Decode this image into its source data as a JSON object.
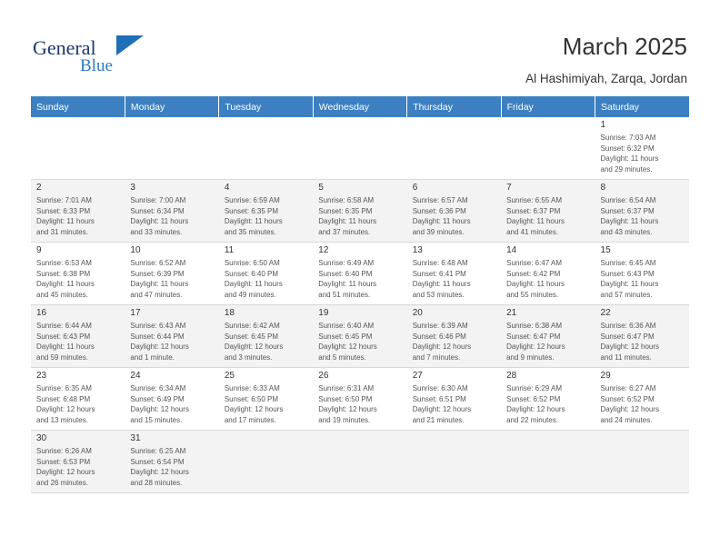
{
  "brand": {
    "name_part1": "General",
    "name_part2": "Blue",
    "flag_icon": "flag-icon"
  },
  "header": {
    "title": "March 2025",
    "location": "Al Hashimiyah, Zarqa, Jordan"
  },
  "calendar": {
    "weekday_headers": [
      "Sunday",
      "Monday",
      "Tuesday",
      "Wednesday",
      "Thursday",
      "Friday",
      "Saturday"
    ],
    "weeks": [
      [
        {
          "day": "",
          "info": ""
        },
        {
          "day": "",
          "info": ""
        },
        {
          "day": "",
          "info": ""
        },
        {
          "day": "",
          "info": ""
        },
        {
          "day": "",
          "info": ""
        },
        {
          "day": "",
          "info": ""
        },
        {
          "day": "1",
          "info": "Sunrise: 7:03 AM\nSunset: 6:32 PM\nDaylight: 11 hours\nand 29 minutes."
        }
      ],
      [
        {
          "day": "2",
          "info": "Sunrise: 7:01 AM\nSunset: 6:33 PM\nDaylight: 11 hours\nand 31 minutes."
        },
        {
          "day": "3",
          "info": "Sunrise: 7:00 AM\nSunset: 6:34 PM\nDaylight: 11 hours\nand 33 minutes."
        },
        {
          "day": "4",
          "info": "Sunrise: 6:59 AM\nSunset: 6:35 PM\nDaylight: 11 hours\nand 35 minutes."
        },
        {
          "day": "5",
          "info": "Sunrise: 6:58 AM\nSunset: 6:35 PM\nDaylight: 11 hours\nand 37 minutes."
        },
        {
          "day": "6",
          "info": "Sunrise: 6:57 AM\nSunset: 6:36 PM\nDaylight: 11 hours\nand 39 minutes."
        },
        {
          "day": "7",
          "info": "Sunrise: 6:55 AM\nSunset: 6:37 PM\nDaylight: 11 hours\nand 41 minutes."
        },
        {
          "day": "8",
          "info": "Sunrise: 6:54 AM\nSunset: 6:37 PM\nDaylight: 11 hours\nand 43 minutes."
        }
      ],
      [
        {
          "day": "9",
          "info": "Sunrise: 6:53 AM\nSunset: 6:38 PM\nDaylight: 11 hours\nand 45 minutes."
        },
        {
          "day": "10",
          "info": "Sunrise: 6:52 AM\nSunset: 6:39 PM\nDaylight: 11 hours\nand 47 minutes."
        },
        {
          "day": "11",
          "info": "Sunrise: 6:50 AM\nSunset: 6:40 PM\nDaylight: 11 hours\nand 49 minutes."
        },
        {
          "day": "12",
          "info": "Sunrise: 6:49 AM\nSunset: 6:40 PM\nDaylight: 11 hours\nand 51 minutes."
        },
        {
          "day": "13",
          "info": "Sunrise: 6:48 AM\nSunset: 6:41 PM\nDaylight: 11 hours\nand 53 minutes."
        },
        {
          "day": "14",
          "info": "Sunrise: 6:47 AM\nSunset: 6:42 PM\nDaylight: 11 hours\nand 55 minutes."
        },
        {
          "day": "15",
          "info": "Sunrise: 6:45 AM\nSunset: 6:43 PM\nDaylight: 11 hours\nand 57 minutes."
        }
      ],
      [
        {
          "day": "16",
          "info": "Sunrise: 6:44 AM\nSunset: 6:43 PM\nDaylight: 11 hours\nand 59 minutes."
        },
        {
          "day": "17",
          "info": "Sunrise: 6:43 AM\nSunset: 6:44 PM\nDaylight: 12 hours\nand 1 minute."
        },
        {
          "day": "18",
          "info": "Sunrise: 6:42 AM\nSunset: 6:45 PM\nDaylight: 12 hours\nand 3 minutes."
        },
        {
          "day": "19",
          "info": "Sunrise: 6:40 AM\nSunset: 6:45 PM\nDaylight: 12 hours\nand 5 minutes."
        },
        {
          "day": "20",
          "info": "Sunrise: 6:39 AM\nSunset: 6:46 PM\nDaylight: 12 hours\nand 7 minutes."
        },
        {
          "day": "21",
          "info": "Sunrise: 6:38 AM\nSunset: 6:47 PM\nDaylight: 12 hours\nand 9 minutes."
        },
        {
          "day": "22",
          "info": "Sunrise: 6:36 AM\nSunset: 6:47 PM\nDaylight: 12 hours\nand 11 minutes."
        }
      ],
      [
        {
          "day": "23",
          "info": "Sunrise: 6:35 AM\nSunset: 6:48 PM\nDaylight: 12 hours\nand 13 minutes."
        },
        {
          "day": "24",
          "info": "Sunrise: 6:34 AM\nSunset: 6:49 PM\nDaylight: 12 hours\nand 15 minutes."
        },
        {
          "day": "25",
          "info": "Sunrise: 6:33 AM\nSunset: 6:50 PM\nDaylight: 12 hours\nand 17 minutes."
        },
        {
          "day": "26",
          "info": "Sunrise: 6:31 AM\nSunset: 6:50 PM\nDaylight: 12 hours\nand 19 minutes."
        },
        {
          "day": "27",
          "info": "Sunrise: 6:30 AM\nSunset: 6:51 PM\nDaylight: 12 hours\nand 21 minutes."
        },
        {
          "day": "28",
          "info": "Sunrise: 6:29 AM\nSunset: 6:52 PM\nDaylight: 12 hours\nand 22 minutes."
        },
        {
          "day": "29",
          "info": "Sunrise: 6:27 AM\nSunset: 6:52 PM\nDaylight: 12 hours\nand 24 minutes."
        }
      ],
      [
        {
          "day": "30",
          "info": "Sunrise: 6:26 AM\nSunset: 6:53 PM\nDaylight: 12 hours\nand 26 minutes."
        },
        {
          "day": "31",
          "info": "Sunrise: 6:25 AM\nSunset: 6:54 PM\nDaylight: 12 hours\nand 28 minutes."
        },
        {
          "day": "",
          "info": ""
        },
        {
          "day": "",
          "info": ""
        },
        {
          "day": "",
          "info": ""
        },
        {
          "day": "",
          "info": ""
        },
        {
          "day": "",
          "info": ""
        }
      ]
    ]
  },
  "colors": {
    "header_bar": "#3d80c2",
    "brand_dark": "#1b3a6b",
    "brand_blue": "#2b7cc4",
    "alt_row": "#f3f3f3"
  }
}
